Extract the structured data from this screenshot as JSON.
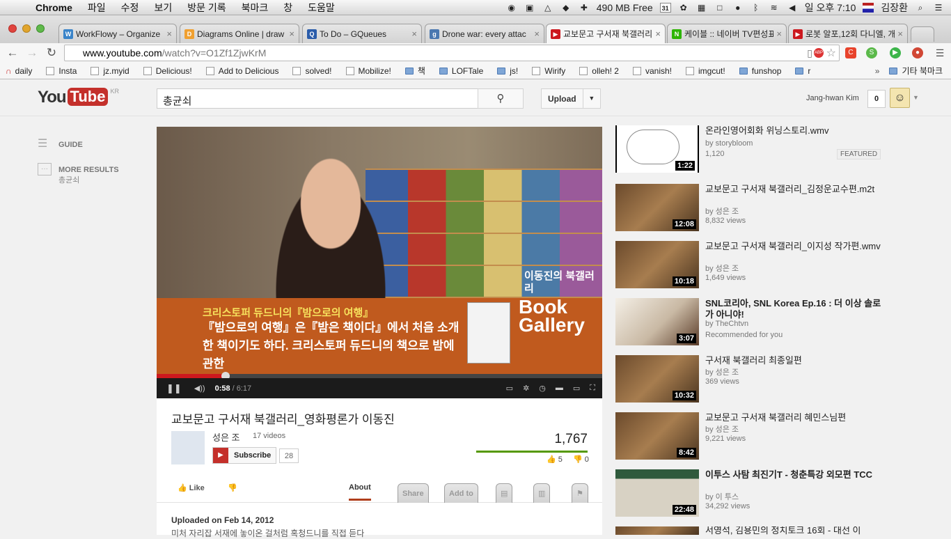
{
  "menubar": {
    "app": "Chrome",
    "menus": [
      "파일",
      "수정",
      "보기",
      "방문 기록",
      "북마크",
      "창",
      "도움말"
    ],
    "memory": "490 MB Free",
    "calendar_day": "31",
    "clock": "일 오후 7:10",
    "user": "김장환"
  },
  "tabs": [
    {
      "title": "WorkFlowy – Organize",
      "color": "#3a84c9",
      "glyph": "W"
    },
    {
      "title": "Diagrams Online | draw",
      "color": "#f0a030",
      "glyph": "D"
    },
    {
      "title": "To Do – GQueues",
      "color": "#2a5caa",
      "glyph": "Q"
    },
    {
      "title": "Drone war: every attac",
      "color": "#4a78b0",
      "glyph": "g"
    },
    {
      "title": "교보문고 구서재 북갤러리_",
      "color": "#cc181e",
      "glyph": "▶"
    },
    {
      "title": "케이블 :: 네이버 TV편성표",
      "color": "#2db400",
      "glyph": "N"
    },
    {
      "title": "로봇 알포,12회 다니엘, 개",
      "color": "#cc181e",
      "glyph": "▶"
    }
  ],
  "toolbar": {
    "url_domain": "www.youtube.com",
    "url_path": "/watch?v=O1Zf1ZjwKrM"
  },
  "bookmarks": [
    {
      "label": "daily",
      "folder": false
    },
    {
      "label": "Insta",
      "folder": false
    },
    {
      "label": "jz.myid",
      "folder": false
    },
    {
      "label": "Delicious!",
      "folder": false
    },
    {
      "label": "Add to Delicious",
      "folder": false
    },
    {
      "label": "solved!",
      "folder": false
    },
    {
      "label": "Mobilize!",
      "folder": false
    },
    {
      "label": "책",
      "folder": true
    },
    {
      "label": "LOFTale",
      "folder": true
    },
    {
      "label": "js!",
      "folder": true
    },
    {
      "label": "Wirify",
      "folder": false
    },
    {
      "label": "olleh! 2",
      "folder": false
    },
    {
      "label": "vanish!",
      "folder": false
    },
    {
      "label": "imgcut!",
      "folder": false
    },
    {
      "label": "funshop",
      "folder": true
    },
    {
      "label": "r",
      "folder": true
    }
  ],
  "bookmarks_other": "기타 북마크",
  "youtube": {
    "logo_you": "You",
    "logo_tube": "Tube",
    "logo_region": "KR",
    "search_value": "총균쇠",
    "upload_label": "Upload",
    "user_name": "Jang-hwan Kim",
    "notification_count": "0"
  },
  "guide": {
    "guide_label": "GUIDE",
    "more_label": "MORE RESULTS",
    "more_sub": "총균쇠"
  },
  "player": {
    "overlay_line1": "크리스토퍼 듀드니의『밤으로의 여행』",
    "overlay_line2": "『밤으로의 여행』은『밤은 책이다』에서 처음 소개한 책이기도 하다. 크리스토퍼 듀드니의 책으로 밤에 관한",
    "book_gallery": "Book Gallery",
    "name_tag": "이동진의 북갤러리",
    "current_time": "0:58",
    "duration": "6:17",
    "progress": 0.154
  },
  "video": {
    "title": "교보문고 구서재 북갤러리_영화평론가 이동진",
    "channel": "성은 조",
    "channel_videos": "17 videos",
    "subscribe_label": "Subscribe",
    "subscriber_count": "28",
    "views": "1,767",
    "likes": "5",
    "dislikes": "0",
    "like_ratio": 1.0,
    "like_label": "Like",
    "tabs": [
      "About",
      "Share",
      "Add to"
    ],
    "uploaded": "Uploaded on Feb 14, 2012",
    "description": "미처 자리잡 서재에 놓이온 걸처럼 혹청드니를 직접 듣다"
  },
  "related": [
    {
      "title": "온라인영어회화 위닝스토리.wmv",
      "by": "by storybloom",
      "views": "1,120",
      "duration": "1:22",
      "featured": "FEATURED"
    },
    {
      "title": "교보문고 구서재 북갤러리_김정운교수편.m2t",
      "by": "by 성은 조",
      "views": "8,832 views",
      "duration": "12:08"
    },
    {
      "title": "교보문고 구서재 북갤러리_이지성 작가편.wmv",
      "by": "by 성은 조",
      "views": "1,649 views",
      "duration": "10:18"
    },
    {
      "title": "SNL코리아, SNL Korea Ep.16 : 더 이상 솔로가 아니야!",
      "by": "by TheChtvn",
      "views": "Recommended for you",
      "duration": "3:07"
    },
    {
      "title": "구서재 북갤러리 최종일편",
      "by": "by 성은 조",
      "views": "369 views",
      "duration": "10:32"
    },
    {
      "title": "교보문고 구서재 북갤러리 혜민스님편",
      "by": "by 성은 조",
      "views": "9,221 views",
      "duration": "8:42"
    },
    {
      "title": "이투스 사탐 최진기T - 청춘특강 외모편 TCC",
      "by": "by 이 투스",
      "views": "34,292 views",
      "duration": "22:48"
    },
    {
      "title": "서영석, 김용민의 정치토크 16회 - 대선 이",
      "by": "",
      "views": "",
      "duration": ""
    }
  ]
}
